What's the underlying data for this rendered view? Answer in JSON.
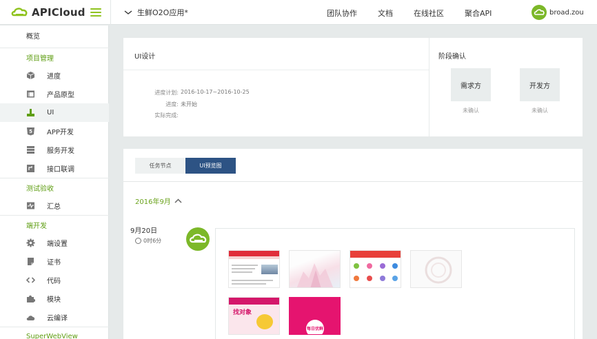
{
  "header": {
    "logo_text": "APICloud",
    "project_name": "生鲜O2O应用*",
    "nav": [
      "团队协作",
      "文档",
      "在线社区",
      "聚合API"
    ],
    "user_name": "broad.zou",
    "brand_color": "#8fc31f"
  },
  "sidebar": {
    "overview": "概览",
    "sections": {
      "project": "项目管理",
      "testing": "测试验收",
      "client": "端开发",
      "superwebview": "SuperWebView"
    },
    "project_items": [
      {
        "label": "进度",
        "icon": "cube-icon"
      },
      {
        "label": "产品原型",
        "icon": "prototype-icon"
      },
      {
        "label": "UI",
        "icon": "brush-icon"
      },
      {
        "label": "APP开发",
        "icon": "html5-icon"
      },
      {
        "label": "服务开发",
        "icon": "server-icon"
      },
      {
        "label": "接口联调",
        "icon": "interface-icon"
      }
    ],
    "testing_items": [
      {
        "label": "汇总",
        "icon": "pulse-icon"
      }
    ],
    "client_items": [
      {
        "label": "端设置",
        "icon": "gear-icon"
      },
      {
        "label": "证书",
        "icon": "certificate-icon"
      },
      {
        "label": "代码",
        "icon": "code-icon"
      },
      {
        "label": "模块",
        "icon": "puzzle-icon"
      },
      {
        "label": "云编译",
        "icon": "cloud-icon"
      }
    ]
  },
  "info": {
    "title": "UI设计",
    "rows": [
      {
        "key": "进度计划:",
        "value": "2016-10-17~2016-10-25"
      },
      {
        "key": "进度:",
        "value": "未开始"
      },
      {
        "key": "实际完成:",
        "value": ""
      }
    ]
  },
  "stage": {
    "title": "阶段确认",
    "parties": [
      {
        "label": "需求方",
        "status": "未确认"
      },
      {
        "label": "开发方",
        "status": "未确认"
      }
    ]
  },
  "preview": {
    "tabs": [
      "任务节点",
      "UI预览图"
    ],
    "active_tab": 1,
    "month": "2016年9月",
    "day": "9月20日",
    "duration": "0时6分",
    "thumb_labels": {
      "t5": "找对象",
      "t6": "每日优鲜"
    }
  }
}
